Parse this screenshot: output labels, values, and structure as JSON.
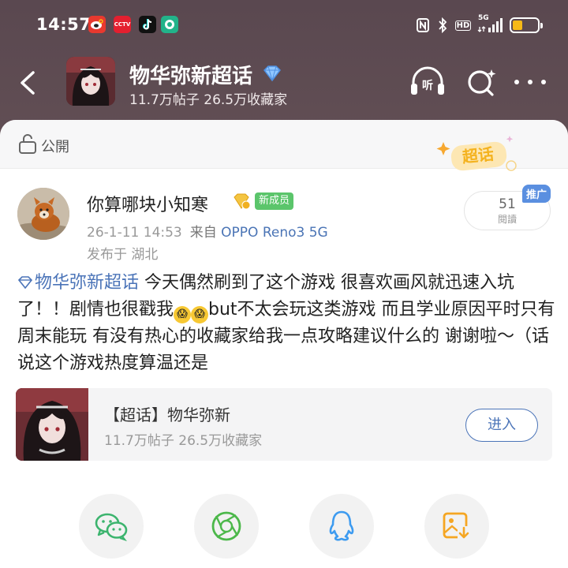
{
  "status_bar": {
    "time": "14:57",
    "notification_apps": [
      {
        "icon": "weibo-icon",
        "color": "#e8392f"
      },
      {
        "icon": "cctv-news-icon",
        "color": "#e41f2f",
        "label": "CCTV"
      },
      {
        "icon": "tiktok-icon",
        "color": "#111111"
      },
      {
        "icon": "chat-bubble-icon",
        "color": "#22b38a"
      }
    ],
    "nfc_label": "N",
    "hd_label": "HD",
    "network_label": "5G",
    "battery_color": "#f7b916"
  },
  "header": {
    "title": "物华弥新超话",
    "stats": "11.7万帖子 26.5万收藏家",
    "listen_label": "听"
  },
  "visibility": {
    "label": "公開"
  },
  "badge": {
    "text": "超话"
  },
  "post": {
    "author": "你算哪块小知寒",
    "newbie_badge": "新成员",
    "time": "26-1-11 14:53",
    "source_prefix": "来自",
    "device": "OPPO Reno3 5G",
    "location": "发布于 湖北",
    "read_count": "51",
    "read_label": "閱讀",
    "promo_tag": "推广",
    "topic": "物华弥新超话",
    "text_part1": " 今天偶然刷到了这个游戏 很喜欢画风就迅速入坑了！！剧情也很戳我",
    "text_part2": "but不太会玩这类游戏 而且学业原因平时只有周末能玩 有没有热心的收藏家给我一点攻略建议什么的 谢谢啦～（话说这个游戏热度算温还是"
  },
  "card": {
    "title": "【超话】物华弥新",
    "stats": "11.7万帖子 26.5万收藏家",
    "enter_label": "进入"
  },
  "share": {
    "wechat_color": "#3cb46e",
    "moments_color": "#4cb84a",
    "qq_color": "#3d9bf0",
    "save_color": "#f5a623"
  }
}
